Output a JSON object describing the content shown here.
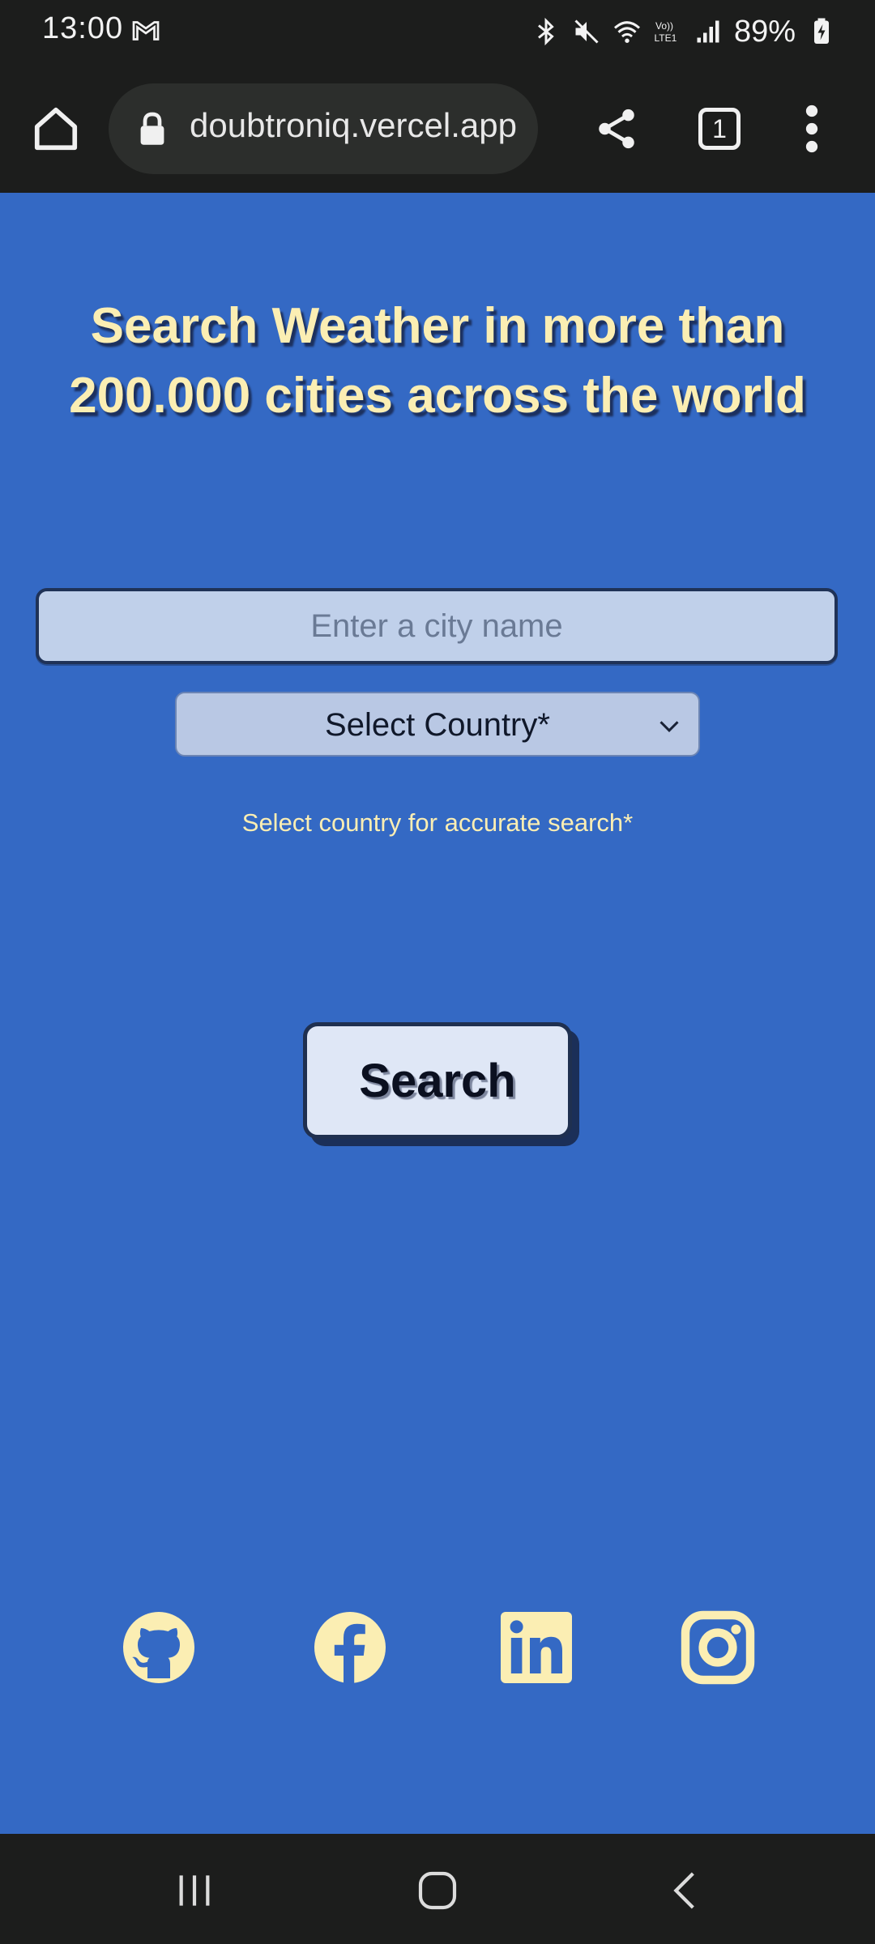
{
  "status_bar": {
    "time": "13:00",
    "battery": "89%",
    "icons": [
      "gmail-icon",
      "bluetooth-icon",
      "mute-icon",
      "wifi-icon",
      "volte-icon",
      "signal-icon",
      "battery-charging-icon"
    ]
  },
  "browser": {
    "url": "doubtroniq.vercel.app",
    "tab_count": "1"
  },
  "page": {
    "headline": "Search Weather in more than 200.000 cities across the world",
    "city_input_placeholder": "Enter a city name",
    "city_input_value": "",
    "country_select_label": "Select Country*",
    "helper_text": "Select country for accurate search*",
    "search_button_label": "Search",
    "social_links": [
      "github-icon",
      "facebook-icon",
      "linkedin-icon",
      "instagram-icon"
    ]
  },
  "colors": {
    "page_background": "#3469c4",
    "accent_text": "#fbeeb3",
    "system_bars": "#1c1d1c"
  }
}
